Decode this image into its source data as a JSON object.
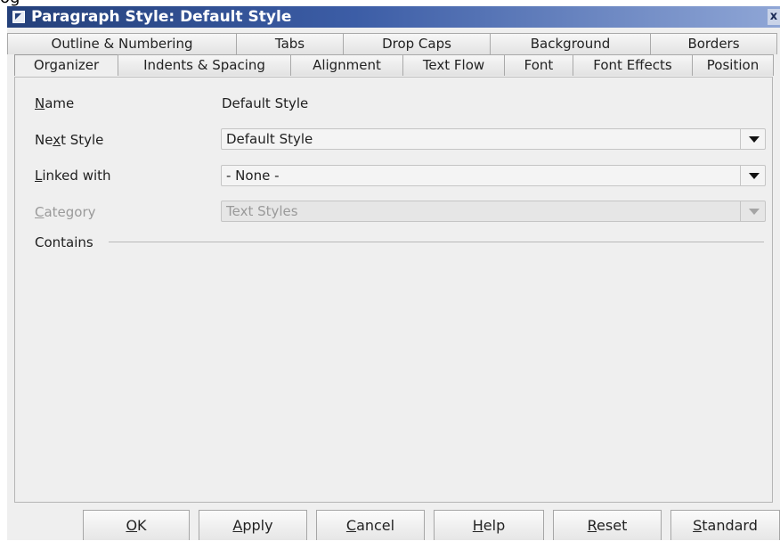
{
  "window": {
    "top_crop_text": "og",
    "title": "Paragraph Style: Default Style",
    "close_glyph": "x"
  },
  "tabs": {
    "row1": [
      "Outline & Numbering",
      "Tabs",
      "Drop Caps",
      "Background",
      "Borders"
    ],
    "row2": [
      "Organizer",
      "Indents & Spacing",
      "Alignment",
      "Text Flow",
      "Font",
      "Font Effects",
      "Position"
    ],
    "active": "Organizer"
  },
  "organizer": {
    "name_label_mnemonic": "N",
    "name_label_rest": "ame",
    "name_value": "Default Style",
    "next_style_label_pre": "Ne",
    "next_style_label_mnemonic": "x",
    "next_style_label_post": "t Style",
    "next_style_value": "Default Style",
    "linked_with_label_mnemonic": "L",
    "linked_with_label_rest": "inked with",
    "linked_with_value": "- None -",
    "category_label_mnemonic": "C",
    "category_label_rest": "ategory",
    "category_value": "Text Styles",
    "contains_label": "Contains"
  },
  "buttons": {
    "ok": {
      "mnemonic": "O",
      "rest": "K"
    },
    "apply": {
      "mnemonic": "A",
      "rest": "pply"
    },
    "cancel": {
      "mnemonic": "C",
      "rest": "ancel"
    },
    "help": {
      "mnemonic": "H",
      "rest": "elp"
    },
    "reset": {
      "mnemonic": "R",
      "rest": "eset"
    },
    "standard": {
      "mnemonic": "S",
      "rest": "tandard"
    }
  },
  "colors": {
    "titlebar_start": "#24407a",
    "titlebar_end": "#8fa6d6",
    "dialog_background": "#efefef",
    "disabled_text": "#9a9a9a"
  }
}
